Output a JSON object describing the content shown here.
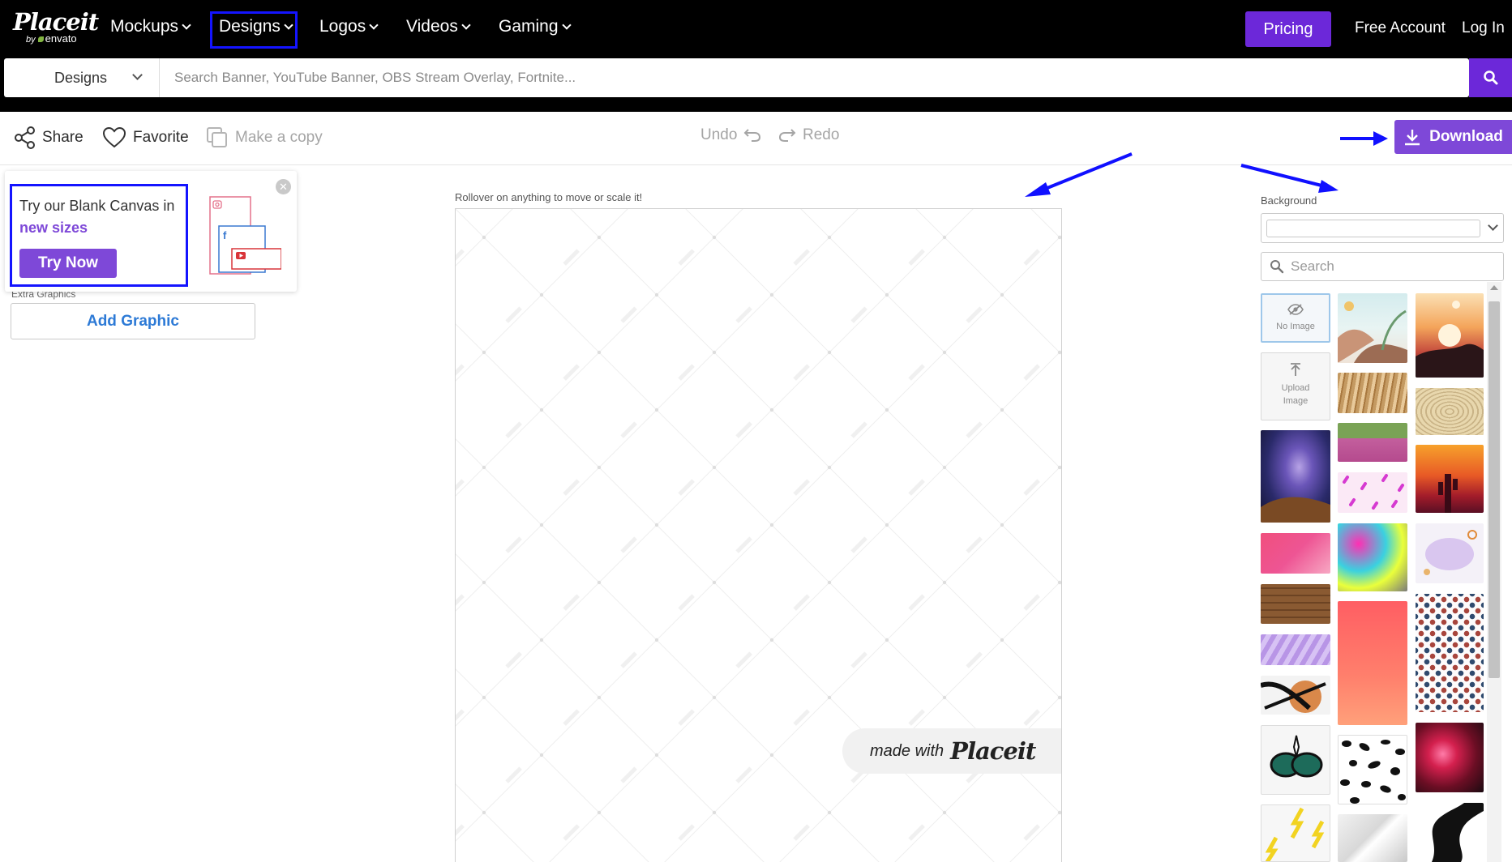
{
  "nav": {
    "logo": "Placeit",
    "logo_by": "by",
    "logo_brand": "envato",
    "items": [
      {
        "label": "Mockups"
      },
      {
        "label": "Designs"
      },
      {
        "label": "Logos"
      },
      {
        "label": "Videos"
      },
      {
        "label": "Gaming"
      }
    ],
    "pricing": "Pricing",
    "free_account": "Free Account",
    "login": "Log In"
  },
  "search": {
    "category": "Designs",
    "placeholder": "Search Banner, YouTube Banner, OBS Stream Overlay, Fortnite..."
  },
  "toolbar": {
    "share": "Share",
    "favorite": "Favorite",
    "copy": "Make a copy",
    "undo": "Undo",
    "redo": "Redo",
    "download": "Download"
  },
  "promo": {
    "text": "Try our Blank Canvas in",
    "accent": "new sizes",
    "button": "Try Now"
  },
  "left_panel": {
    "section_label": "Extra Graphics",
    "add_graphic": "Add Graphic"
  },
  "canvas": {
    "hint": "Rollover on anything to move or scale it!",
    "watermark_small": "made with",
    "watermark_brand": "Placeit"
  },
  "background_panel": {
    "label": "Background",
    "search_placeholder": "Search",
    "no_image": "No Image",
    "upload_line1": "Upload",
    "upload_line2": "Image"
  },
  "colors": {
    "brand_purple": "#6c28d9",
    "button_purple": "#7e48d8",
    "link_blue": "#2d7ad6",
    "highlight_blue": "#1414ff"
  }
}
